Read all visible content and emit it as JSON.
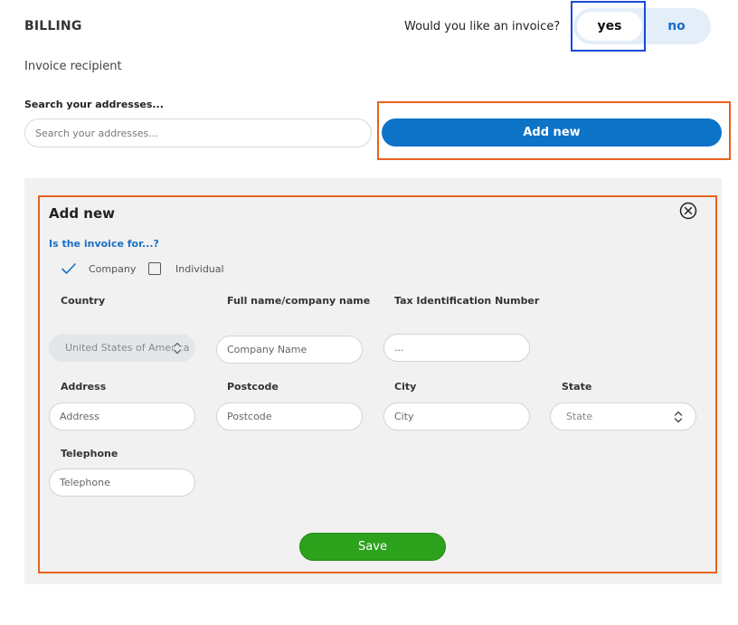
{
  "billing": {
    "title": "BILLING",
    "invoice_question": "Would you like an invoice?",
    "invoice_toggle": {
      "yes_label": "yes",
      "no_label": "no",
      "selected": "yes"
    }
  },
  "recipient": {
    "heading": "Invoice recipient",
    "search_label": "Search your addresses...",
    "search_placeholder": "Search your addresses...",
    "add_new_label": "Add new"
  },
  "form": {
    "title": "Add new",
    "close_icon": "close-circle-icon",
    "question": "Is the invoice for...?",
    "options": [
      {
        "label": "Company",
        "checked": true
      },
      {
        "label": "Individual",
        "checked": false
      }
    ],
    "fields": {
      "country": {
        "label": "Country",
        "value": "United States of America"
      },
      "name": {
        "label": "Full name/company name",
        "placeholder": "Company Name"
      },
      "tax": {
        "label": "Tax Identification Number",
        "placeholder": "..."
      },
      "address": {
        "label": "Address",
        "placeholder": "Address"
      },
      "postcode": {
        "label": "Postcode",
        "placeholder": "Postcode"
      },
      "city": {
        "label": "City",
        "placeholder": "City"
      },
      "state": {
        "label": "State",
        "placeholder": "State"
      },
      "telephone": {
        "label": "Telephone",
        "placeholder": "Telephone"
      }
    },
    "save_label": "Save"
  },
  "colors": {
    "accent_blue": "#0d73c7",
    "link_blue": "#1a6fc4",
    "save_green": "#2da21c",
    "highlight_orange": "#e8621e",
    "highlight_blue": "#1849d6",
    "panel_bg": "#f1f1f1"
  }
}
